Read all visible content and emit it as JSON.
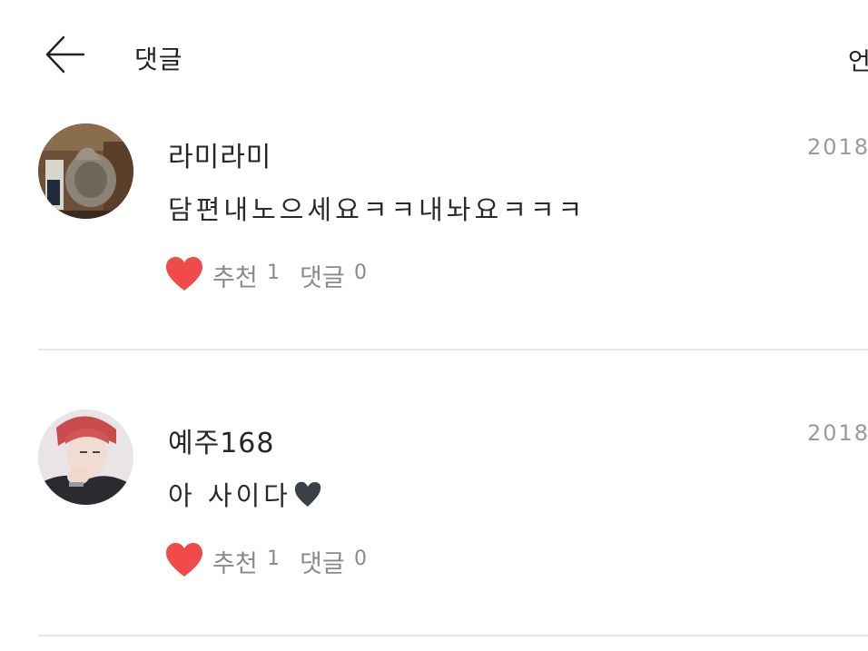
{
  "header": {
    "title": "댓글",
    "right_label": "언",
    "back_icon": "arrow-left-icon"
  },
  "comments": [
    {
      "username": "라미라미",
      "date": "2018.",
      "text": "담편내노으세요ㅋㅋ내놔요ㅋㅋㅋ",
      "recommend_label": "추천",
      "recommend_count": "1",
      "reply_label": "댓글",
      "reply_count": "0"
    },
    {
      "username": "예주168",
      "date": "2018.",
      "text": "아 사이다",
      "recommend_label": "추천",
      "recommend_count": "1",
      "reply_label": "댓글",
      "reply_count": "0"
    }
  ],
  "colors": {
    "heart": "#f04a4a",
    "muted_text": "#8a8a8a",
    "date_text": "#9a9a9a",
    "divider": "#e6e6e6"
  }
}
